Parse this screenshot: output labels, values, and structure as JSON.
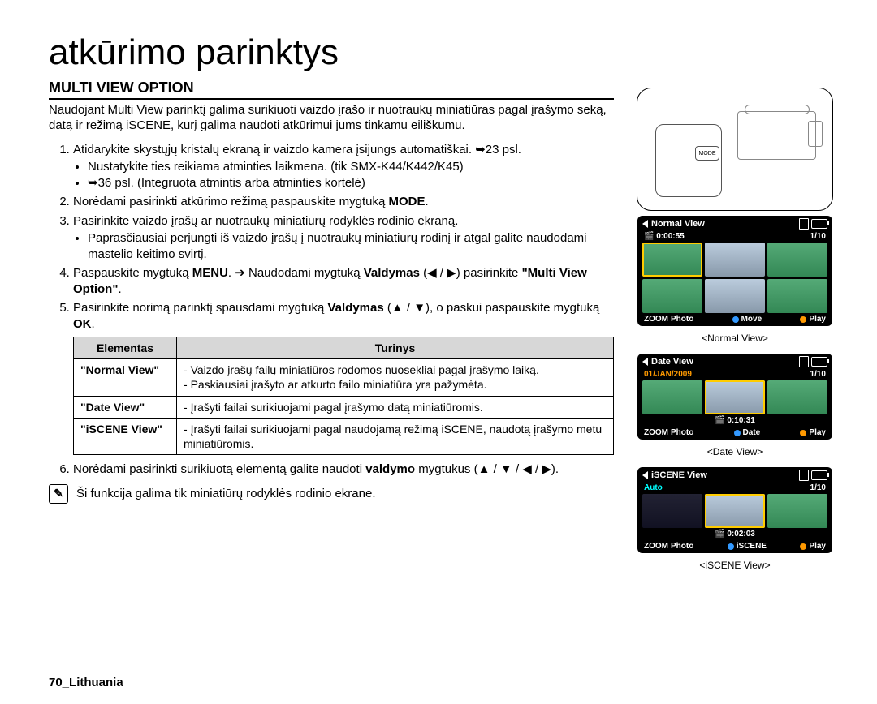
{
  "title": "atkūrimo parinktys",
  "section_heading": "MULTI VIEW OPTION",
  "intro": "Naudojant Multi View parinktį galima surikiuoti vaizdo įrašo ir nuotraukų miniatiūras pagal įrašymo seką, datą ir režimą iSCENE, kurį galima naudoti atkūrimui jums tinkamu eiliškumu.",
  "steps": {
    "s1": {
      "text_a": "Atidarykite skystųjų kristalų ekraną ir vaizdo kamera įsijungs automatiškai. ",
      "page_ref": "23 psl.",
      "bullet_a": "Nustatykite ties reikiama atminties laikmena. (tik SMX-K44/K442/K45)",
      "bullet_b_pre": "",
      "bullet_b_ref": "36 psl. (Integruota atmintis arba atminties kortelė)"
    },
    "s2": {
      "text_a": "Norėdami pasirinkti atkūrimo režimą paspauskite mygtuką ",
      "bold": "MODE",
      "text_b": "."
    },
    "s3": {
      "text_a": "Pasirinkite vaizdo įrašų ar nuotraukų miniatiūrų rodyklės rodinio ekraną.",
      "bullet": "Paprasčiausiai perjungti iš vaizdo įrašų į nuotraukų miniatiūrų rodinį ir atgal galite naudodami mastelio keitimo svirtį."
    },
    "s4": {
      "text_a": "Paspauskite mygtuką ",
      "bold_a": "MENU",
      "text_b": ". ➔ Naudodami mygtuką ",
      "bold_b": "Valdymas",
      "text_c": " (◀ / ▶) pasirinkite ",
      "bold_c": "\"Multi View Option\"",
      "text_d": "."
    },
    "s5": {
      "text_a": "Pasirinkite norimą parinktį spausdami mygtuką ",
      "bold_a": "Valdymas",
      "text_b": " (▲ / ▼), o paskui paspauskite mygtuką ",
      "bold_b": "OK",
      "text_c": "."
    },
    "s6": {
      "text_a": "Norėdami pasirinkti surikiuotą elementą galite naudoti ",
      "bold": "valdymo",
      "text_b": " mygtukus (▲ / ▼ / ◀ / ▶)."
    }
  },
  "table": {
    "head_element": "Elementas",
    "head_content": "Turinys",
    "rows": [
      {
        "key": "\"Normal View\"",
        "lines": [
          "Vaizdo įrašų failų miniatiūros rodomos nuosekliai pagal įrašymo laiką.",
          "Paskiausiai įrašyto ar atkurto failo miniatiūra yra pažymėta."
        ]
      },
      {
        "key": "\"Date View\"",
        "lines": [
          "Įrašyti failai surikiuojami pagal įrašymo datą miniatiūromis."
        ]
      },
      {
        "key": "\"iSCENE View\"",
        "lines": [
          "Įrašyti failai surikiuojami pagal naudojamą režimą iSCENE, naudotą įrašymo metu miniatiūromis."
        ]
      }
    ]
  },
  "note": "Ši funkcija galima tik miniatiūrų rodyklės rodinio ekrane.",
  "footer": "70_Lithuania",
  "camcorder": {
    "mode_label": "MODE"
  },
  "lcd": {
    "normal": {
      "title": "Normal View",
      "time_top": "0:00:55",
      "count": "1/10",
      "zoom": "Photo",
      "move": "Move",
      "play": "Play",
      "caption": "<Normal View>"
    },
    "date": {
      "title": "Date View",
      "date": "01/JAN/2009",
      "count": "1/10",
      "time": "0:10:31",
      "zoom": "Photo",
      "mid": "Date",
      "play": "Play",
      "caption": "<Date View>"
    },
    "iscene": {
      "title": "iSCENE View",
      "mode": "Auto",
      "count": "1/10",
      "time": "0:02:03",
      "zoom": "Photo",
      "mid": "iSCENE",
      "play": "Play",
      "caption": "<iSCENE View>"
    }
  },
  "icons": {
    "note": "✎",
    "zoom_label": "ZOOM"
  }
}
